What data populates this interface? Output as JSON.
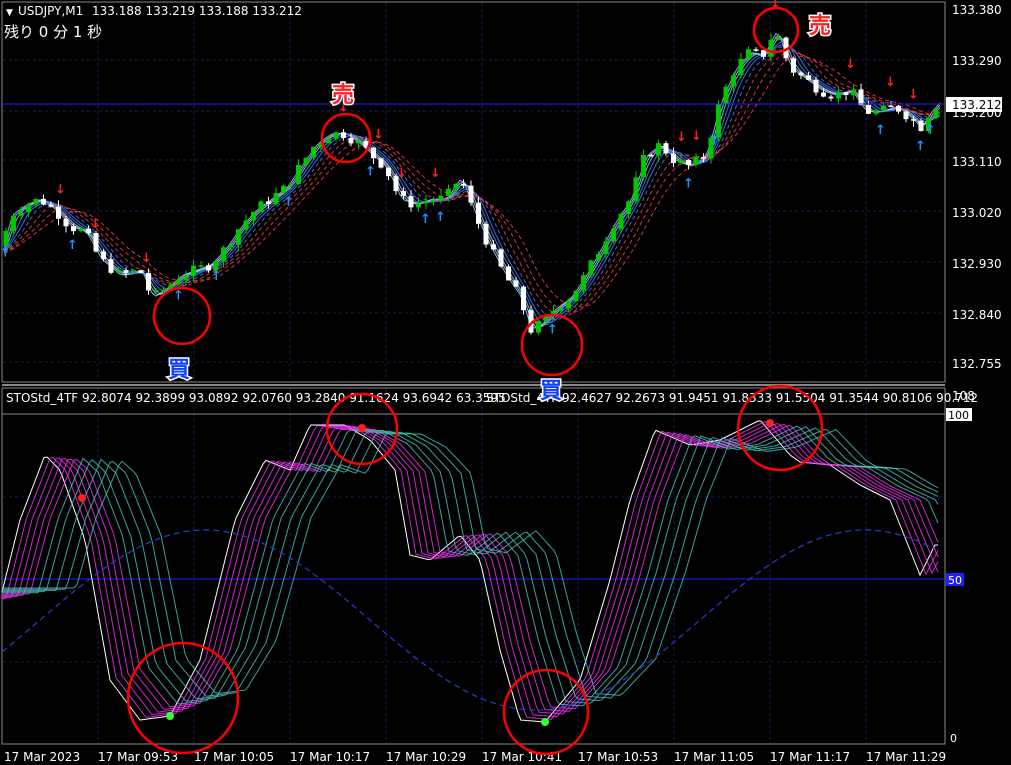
{
  "header": {
    "symbol": "USDJPY,M1",
    "ohlc": "133.188 133.219 133.188 133.212",
    "countdown": "残り 0 分 1 秒"
  },
  "price_axis": {
    "ticks": [
      "133.380",
      "133.290",
      "133.200",
      "133.110",
      "133.020",
      "132.930",
      "132.840",
      "132.755"
    ],
    "current_price": "133.212"
  },
  "indicator": {
    "label_1": "STOStd_4TF 92.8074 92.3899 93.0892 92.0760 93.2840 91.1624 93.6942 63.3595",
    "label_2": "STOStd_4TF 92.4627 92.2673 91.9451 91.8333 91.5504 91.3544 90.8106 90.712",
    "axis_top": "108",
    "level_100": "100",
    "level_mid": "50",
    "axis_bottom": "0"
  },
  "time_axis": {
    "labels": [
      "17 Mar 2023",
      "17 Mar 09:53",
      "17 Mar 10:05",
      "17 Mar 10:17",
      "17 Mar 10:29",
      "17 Mar 10:41",
      "17 Mar 10:53",
      "17 Mar 11:05",
      "17 Mar 11:17",
      "17 Mar 11:29"
    ]
  },
  "annotations": {
    "sell_label": "売",
    "buy_label": "買"
  },
  "colors": {
    "background": "#000000",
    "grid": "#1c1c5a",
    "bull_candle": "#00c800",
    "bear_candle": "#ffffff",
    "sell_arrow": "#ff2020",
    "buy_arrow": "#1e90ff",
    "circle": "#ff0000",
    "current_price_line": "#2020ff",
    "sto_magenta": "#ff33ff",
    "sto_teal": "#4dc8c0",
    "sto_white": "#ffffff"
  },
  "chart_data": {
    "type": "candlestick",
    "symbol": "USDJPY",
    "timeframe": "M1",
    "ylim": [
      132.74,
      133.39
    ],
    "close_path": [
      [
        0,
        132.94
      ],
      [
        10,
        133.01
      ],
      [
        25,
        133.03
      ],
      [
        40,
        133.04
      ],
      [
        55,
        133.02
      ],
      [
        70,
        132.99
      ],
      [
        85,
        132.98
      ],
      [
        100,
        132.93
      ],
      [
        120,
        132.9
      ],
      [
        140,
        132.91
      ],
      [
        152,
        132.86
      ],
      [
        168,
        132.88
      ],
      [
        180,
        132.9
      ],
      [
        195,
        132.91
      ],
      [
        210,
        132.92
      ],
      [
        225,
        132.95
      ],
      [
        240,
        132.99
      ],
      [
        255,
        133.02
      ],
      [
        270,
        133.04
      ],
      [
        285,
        133.06
      ],
      [
        300,
        133.1
      ],
      [
        315,
        133.14
      ],
      [
        330,
        133.16
      ],
      [
        345,
        133.16
      ],
      [
        360,
        133.14
      ],
      [
        372,
        133.12
      ],
      [
        385,
        133.1
      ],
      [
        400,
        133.04
      ],
      [
        415,
        133.03
      ],
      [
        430,
        133.04
      ],
      [
        445,
        133.04
      ],
      [
        460,
        133.08
      ],
      [
        475,
        133.01
      ],
      [
        490,
        132.95
      ],
      [
        505,
        132.9
      ],
      [
        520,
        132.86
      ],
      [
        530,
        132.8
      ],
      [
        540,
        132.81
      ],
      [
        555,
        132.84
      ],
      [
        570,
        132.86
      ],
      [
        585,
        132.9
      ],
      [
        600,
        132.95
      ],
      [
        615,
        133.0
      ],
      [
        630,
        133.04
      ],
      [
        645,
        133.12
      ],
      [
        660,
        133.14
      ],
      [
        675,
        133.11
      ],
      [
        690,
        133.1
      ],
      [
        705,
        133.12
      ],
      [
        720,
        133.22
      ],
      [
        735,
        133.28
      ],
      [
        750,
        133.31
      ],
      [
        762,
        133.3
      ],
      [
        775,
        133.35
      ],
      [
        790,
        133.28
      ],
      [
        805,
        133.26
      ],
      [
        820,
        133.24
      ],
      [
        835,
        133.23
      ],
      [
        850,
        133.24
      ],
      [
        865,
        133.2
      ],
      [
        880,
        133.2
      ],
      [
        895,
        133.21
      ],
      [
        910,
        133.19
      ],
      [
        920,
        133.17
      ],
      [
        930,
        133.2
      ],
      [
        940,
        133.22
      ]
    ],
    "sell_signal_times": [
      "17 Mar 10:17",
      "17 Mar 11:17"
    ],
    "buy_signal_times": [
      "17 Mar 09:53",
      "17 Mar 10:41"
    ]
  }
}
